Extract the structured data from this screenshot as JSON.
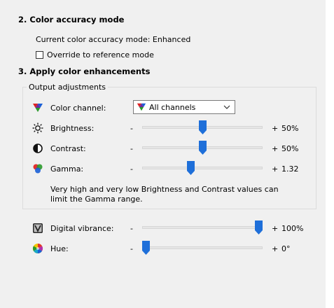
{
  "section2": {
    "title": "2. Color accuracy mode",
    "current_mode": "Current color accuracy mode: Enhanced",
    "override_label": "Override to reference mode",
    "override_checked": false
  },
  "section3": {
    "title": "3. Apply color enhancements",
    "group_title": "Output adjustments",
    "color_channel": {
      "label": "Color channel:",
      "selected": "All channels",
      "icon": "rgb-channels-icon"
    },
    "brightness": {
      "label": "Brightness:",
      "minus": "-",
      "plus": "+",
      "value_text": "50%",
      "level": 0.5,
      "icon": "sun-icon"
    },
    "contrast": {
      "label": "Contrast:",
      "minus": "-",
      "plus": "+",
      "value_text": "50%",
      "level": 0.5,
      "icon": "contrast-icon"
    },
    "gamma": {
      "label": "Gamma:",
      "minus": "-",
      "plus": "+",
      "value_text": "1.32",
      "level": 0.4,
      "icon": "rgb-circles-icon"
    },
    "note": "Very high and very low Brightness and Contrast values can limit the Gamma range.",
    "vibrance": {
      "label": "Digital vibrance:",
      "minus": "-",
      "plus": "+",
      "value_text": "100%",
      "level": 1.0,
      "icon": "vibrance-icon"
    },
    "hue": {
      "label": "Hue:",
      "minus": "-",
      "plus": "+",
      "value_text": "0°",
      "level": 0.0,
      "icon": "color-wheel-icon"
    }
  },
  "colors": {
    "background": "#f0f0f0",
    "slider_thumb": "#1e6fd9",
    "track": "#e6e6e6"
  }
}
